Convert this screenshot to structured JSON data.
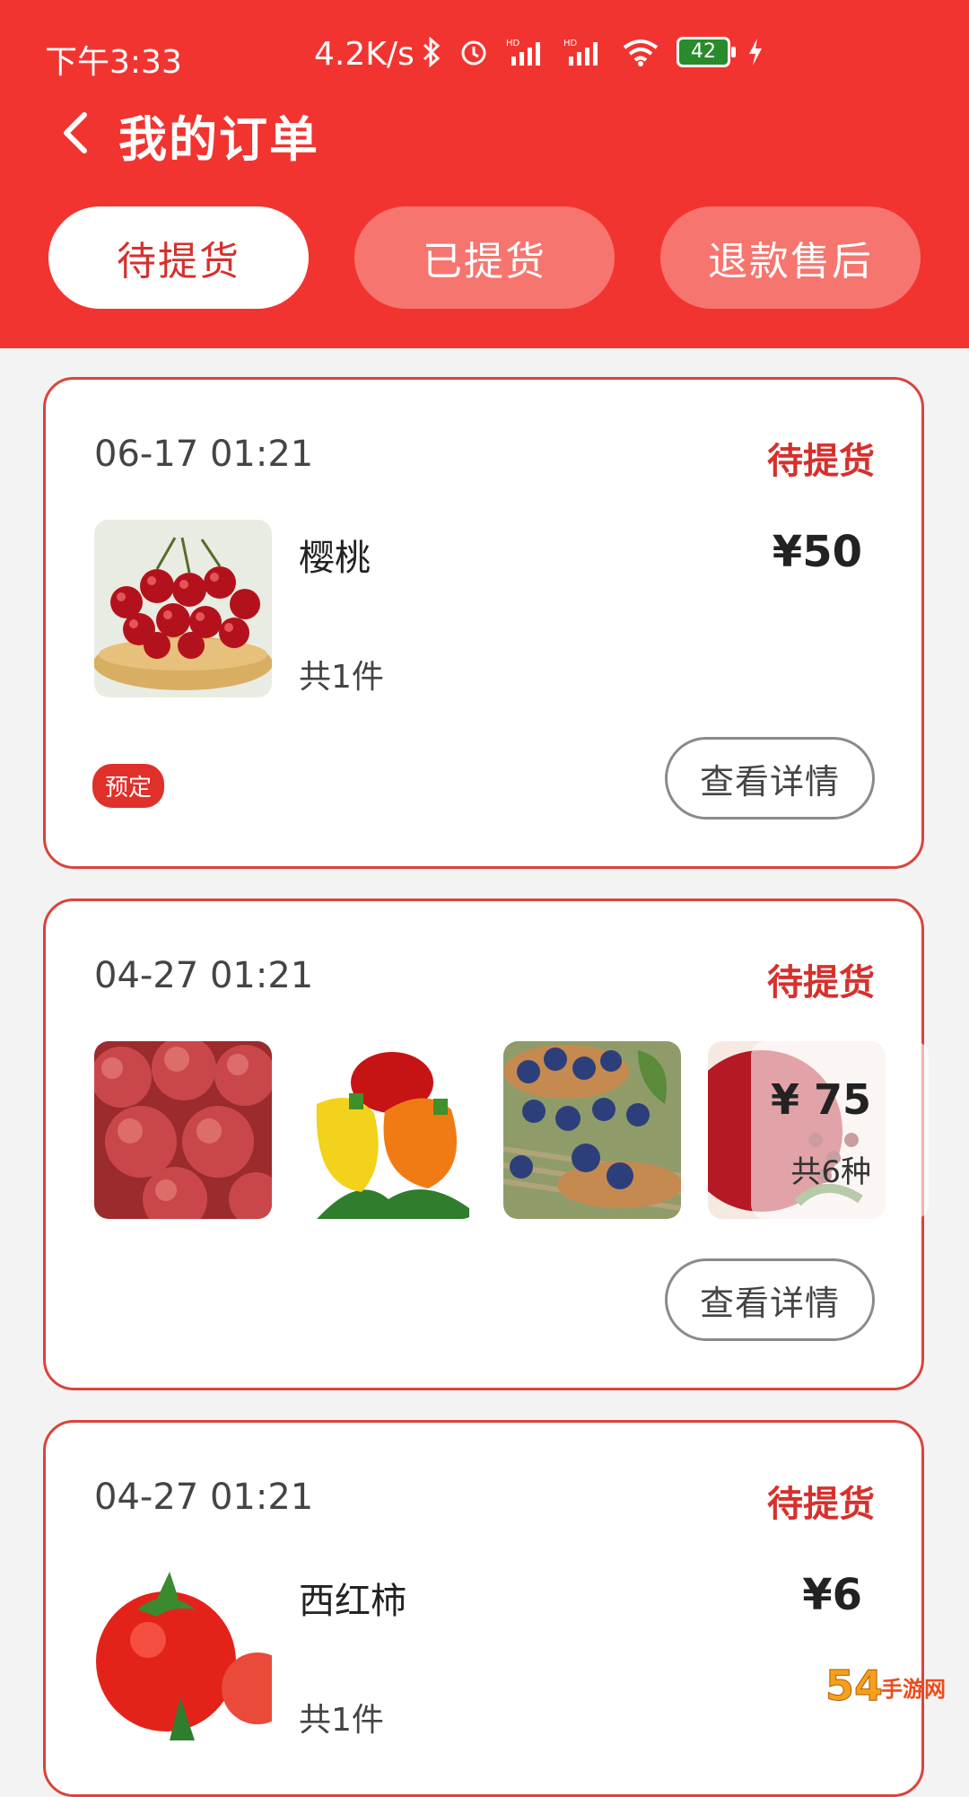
{
  "status_bar": {
    "time": "下午3:33",
    "net_speed": "4.2K/s",
    "battery": "42",
    "icons": [
      "bluetooth-icon",
      "alarm-icon",
      "hd-signal-icon",
      "hd-signal-icon",
      "wifi-icon",
      "battery-icon",
      "charging-icon"
    ]
  },
  "header": {
    "title": "我的订单",
    "tabs": [
      {
        "label": "待提货",
        "active": true
      },
      {
        "label": "已提货",
        "active": false
      },
      {
        "label": "退款售后",
        "active": false
      }
    ],
    "color": "#f23430"
  },
  "orders": [
    {
      "date": "06-17 01:21",
      "status": "待提货",
      "product_name": "樱桃",
      "count": "共1件",
      "price": "¥50",
      "tag": "预定",
      "detail_label": "查看详情",
      "images": [
        "cherry-image"
      ]
    },
    {
      "date": "04-27 01:21",
      "status": "待提货",
      "price": "¥ 75",
      "count": "共6种",
      "detail_label": "查看详情",
      "images": [
        "apple-image",
        "pepper-image",
        "blueberry-image",
        "pomegranate-image"
      ]
    },
    {
      "date": "04-27 01:21",
      "status": "待提货",
      "product_name": "西红柿",
      "count": "共1件",
      "price": "¥6",
      "images": [
        "tomato-image"
      ]
    }
  ],
  "watermark": "54手游网"
}
